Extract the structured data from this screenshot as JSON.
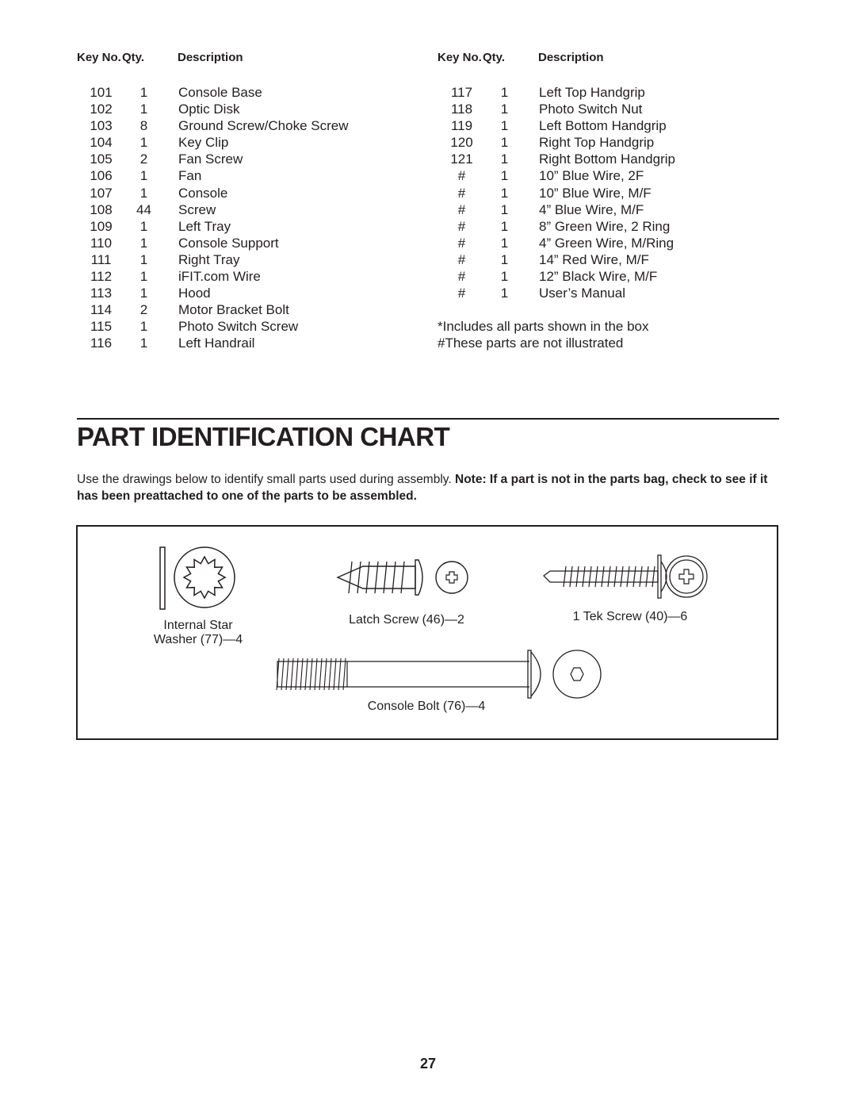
{
  "parts_list": {
    "headers": {
      "key_no": "Key No.",
      "qty": "Qty.",
      "description": "Description"
    },
    "left_column": [
      {
        "key": "101",
        "qty": "1",
        "description": "Console Base"
      },
      {
        "key": "102",
        "qty": "1",
        "description": "Optic Disk"
      },
      {
        "key": "103",
        "qty": "8",
        "description": "Ground Screw/Choke Screw"
      },
      {
        "key": "104",
        "qty": "1",
        "description": "Key Clip"
      },
      {
        "key": "105",
        "qty": "2",
        "description": "Fan Screw"
      },
      {
        "key": "106",
        "qty": "1",
        "description": "Fan"
      },
      {
        "key": "107",
        "qty": "1",
        "description": "Console"
      },
      {
        "key": "108",
        "qty": "44",
        "description": "Screw"
      },
      {
        "key": "109",
        "qty": "1",
        "description": "Left Tray"
      },
      {
        "key": "110",
        "qty": "1",
        "description": "Console Support"
      },
      {
        "key": "111",
        "qty": "1",
        "description": "Right Tray"
      },
      {
        "key": "112",
        "qty": "1",
        "description": "iFIT.com Wire"
      },
      {
        "key": "113",
        "qty": "1",
        "description": "Hood"
      },
      {
        "key": "114",
        "qty": "2",
        "description": "Motor Bracket Bolt"
      },
      {
        "key": "115",
        "qty": "1",
        "description": "Photo Switch Screw"
      },
      {
        "key": "116",
        "qty": "1",
        "description": "Left Handrail"
      }
    ],
    "right_column": [
      {
        "key": "117",
        "qty": "1",
        "description": "Left Top Handgrip"
      },
      {
        "key": "118",
        "qty": "1",
        "description": "Photo Switch Nut"
      },
      {
        "key": "119",
        "qty": "1",
        "description": "Left Bottom Handgrip"
      },
      {
        "key": "120",
        "qty": "1",
        "description": "Right Top Handgrip"
      },
      {
        "key": "121",
        "qty": "1",
        "description": "Right Bottom Handgrip"
      },
      {
        "key": "#",
        "qty": "1",
        "description": "10” Blue Wire, 2F"
      },
      {
        "key": "#",
        "qty": "1",
        "description": "10” Blue Wire, M/F"
      },
      {
        "key": "#",
        "qty": "1",
        "description": "4” Blue Wire, M/F"
      },
      {
        "key": "#",
        "qty": "1",
        "description": "8” Green Wire, 2 Ring"
      },
      {
        "key": "#",
        "qty": "1",
        "description": "4” Green Wire, M/Ring"
      },
      {
        "key": "#",
        "qty": "1",
        "description": "14” Red Wire, M/F"
      },
      {
        "key": "#",
        "qty": "1",
        "description": "12” Black Wire, M/F"
      },
      {
        "key": "#",
        "qty": "1",
        "description": "User’s Manual"
      }
    ],
    "notes": [
      "*Includes all parts shown in the box",
      "#These parts are not illustrated"
    ]
  },
  "section": {
    "title": "PART IDENTIFICATION CHART",
    "intro_text": "Use the drawings below to identify small parts used during assembly. ",
    "intro_note": "Note: If a part is not in the parts bag, check to see if it has been preattached to one of the parts to be assembled."
  },
  "parts_chart": {
    "washer": {
      "label_line1": "Internal Star",
      "label_line2": "Washer (77)—4",
      "icon": "internal-star-washer-icon"
    },
    "latch_screw": {
      "label": "Latch Screw (46)—2",
      "icon": "latch-screw-icon"
    },
    "tek_screw": {
      "label": "1  Tek Screw (40)—6",
      "icon": "tek-screw-icon"
    },
    "console_bolt": {
      "label": "Console Bolt (76)—4",
      "icon": "console-bolt-icon"
    }
  },
  "page_number": "27"
}
